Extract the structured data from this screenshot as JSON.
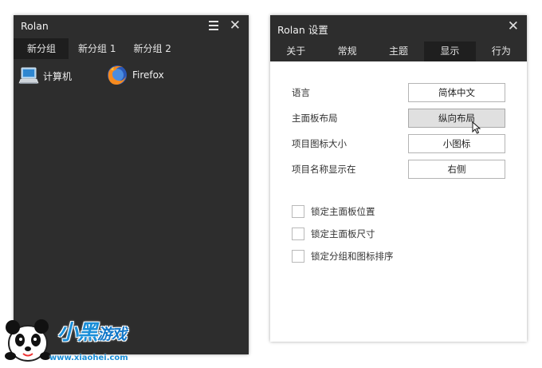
{
  "launcher": {
    "title": "Rolan",
    "tabs": [
      "新分组",
      "新分组 1",
      "新分组 2"
    ],
    "items": [
      {
        "label": "计算机",
        "icon": "computer-icon"
      },
      {
        "label": "Firefox",
        "icon": "firefox-icon"
      }
    ]
  },
  "watermark": {
    "brand": "小黑",
    "brand_suffix": "游戏",
    "url": "www.xiaohei.com"
  },
  "settings": {
    "title": "Rolan 设置",
    "tabs": [
      "关于",
      "常规",
      "主题",
      "显示",
      "行为"
    ],
    "active_tab": "显示",
    "rows": [
      {
        "label": "语言",
        "value": "简体中文"
      },
      {
        "label": "主面板布局",
        "value": "纵向布局"
      },
      {
        "label": "项目图标大小",
        "value": "小图标"
      },
      {
        "label": "项目名称显示在",
        "value": "右侧"
      }
    ],
    "checkboxes": [
      {
        "label": "锁定主面板位置",
        "checked": false
      },
      {
        "label": "锁定主面板尺寸",
        "checked": false
      },
      {
        "label": "锁定分组和图标排序",
        "checked": false
      }
    ]
  },
  "colors": {
    "panel_bg": "#2d2d2d",
    "active_tab_bg": "#1e1e1e",
    "watermark_blue": "#1a8ed8"
  }
}
